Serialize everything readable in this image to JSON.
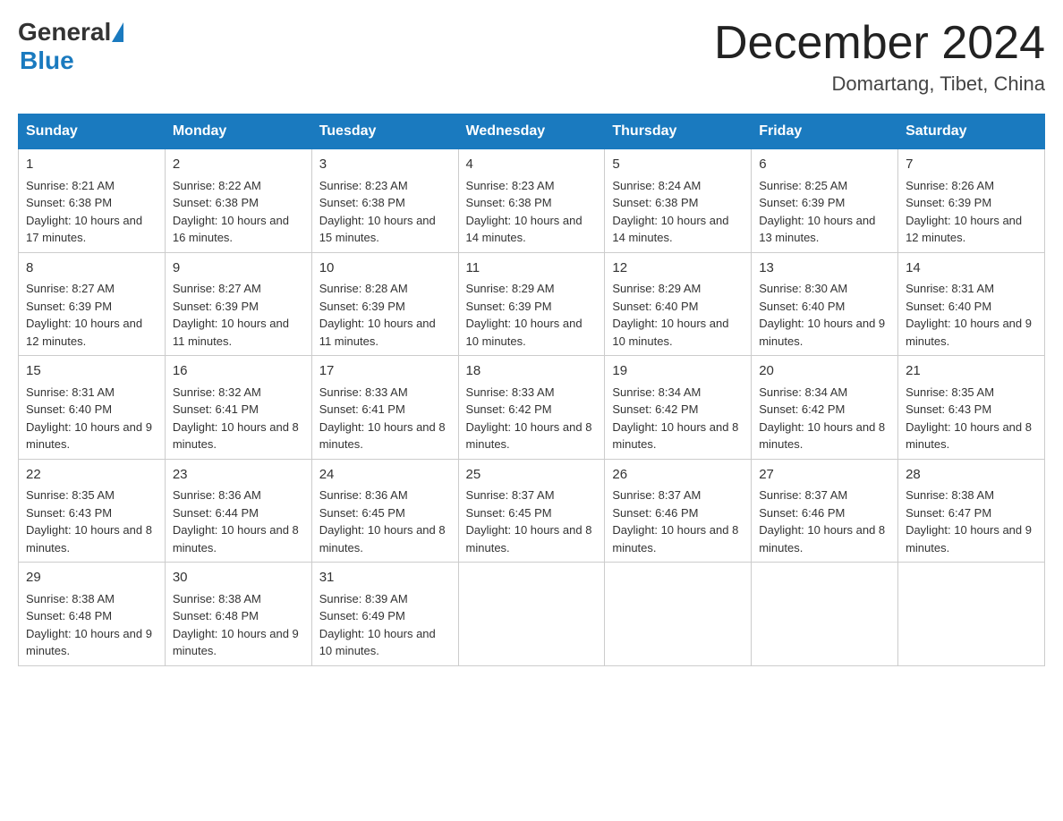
{
  "header": {
    "logo_general": "General",
    "logo_blue": "Blue",
    "month_title": "December 2024",
    "location": "Domartang, Tibet, China"
  },
  "days_of_week": [
    "Sunday",
    "Monday",
    "Tuesday",
    "Wednesday",
    "Thursday",
    "Friday",
    "Saturday"
  ],
  "weeks": [
    [
      {
        "day": "1",
        "sunrise": "8:21 AM",
        "sunset": "6:38 PM",
        "daylight": "10 hours and 17 minutes."
      },
      {
        "day": "2",
        "sunrise": "8:22 AM",
        "sunset": "6:38 PM",
        "daylight": "10 hours and 16 minutes."
      },
      {
        "day": "3",
        "sunrise": "8:23 AM",
        "sunset": "6:38 PM",
        "daylight": "10 hours and 15 minutes."
      },
      {
        "day": "4",
        "sunrise": "8:23 AM",
        "sunset": "6:38 PM",
        "daylight": "10 hours and 14 minutes."
      },
      {
        "day": "5",
        "sunrise": "8:24 AM",
        "sunset": "6:38 PM",
        "daylight": "10 hours and 14 minutes."
      },
      {
        "day": "6",
        "sunrise": "8:25 AM",
        "sunset": "6:39 PM",
        "daylight": "10 hours and 13 minutes."
      },
      {
        "day": "7",
        "sunrise": "8:26 AM",
        "sunset": "6:39 PM",
        "daylight": "10 hours and 12 minutes."
      }
    ],
    [
      {
        "day": "8",
        "sunrise": "8:27 AM",
        "sunset": "6:39 PM",
        "daylight": "10 hours and 12 minutes."
      },
      {
        "day": "9",
        "sunrise": "8:27 AM",
        "sunset": "6:39 PM",
        "daylight": "10 hours and 11 minutes."
      },
      {
        "day": "10",
        "sunrise": "8:28 AM",
        "sunset": "6:39 PM",
        "daylight": "10 hours and 11 minutes."
      },
      {
        "day": "11",
        "sunrise": "8:29 AM",
        "sunset": "6:39 PM",
        "daylight": "10 hours and 10 minutes."
      },
      {
        "day": "12",
        "sunrise": "8:29 AM",
        "sunset": "6:40 PM",
        "daylight": "10 hours and 10 minutes."
      },
      {
        "day": "13",
        "sunrise": "8:30 AM",
        "sunset": "6:40 PM",
        "daylight": "10 hours and 9 minutes."
      },
      {
        "day": "14",
        "sunrise": "8:31 AM",
        "sunset": "6:40 PM",
        "daylight": "10 hours and 9 minutes."
      }
    ],
    [
      {
        "day": "15",
        "sunrise": "8:31 AM",
        "sunset": "6:40 PM",
        "daylight": "10 hours and 9 minutes."
      },
      {
        "day": "16",
        "sunrise": "8:32 AM",
        "sunset": "6:41 PM",
        "daylight": "10 hours and 8 minutes."
      },
      {
        "day": "17",
        "sunrise": "8:33 AM",
        "sunset": "6:41 PM",
        "daylight": "10 hours and 8 minutes."
      },
      {
        "day": "18",
        "sunrise": "8:33 AM",
        "sunset": "6:42 PM",
        "daylight": "10 hours and 8 minutes."
      },
      {
        "day": "19",
        "sunrise": "8:34 AM",
        "sunset": "6:42 PM",
        "daylight": "10 hours and 8 minutes."
      },
      {
        "day": "20",
        "sunrise": "8:34 AM",
        "sunset": "6:42 PM",
        "daylight": "10 hours and 8 minutes."
      },
      {
        "day": "21",
        "sunrise": "8:35 AM",
        "sunset": "6:43 PM",
        "daylight": "10 hours and 8 minutes."
      }
    ],
    [
      {
        "day": "22",
        "sunrise": "8:35 AM",
        "sunset": "6:43 PM",
        "daylight": "10 hours and 8 minutes."
      },
      {
        "day": "23",
        "sunrise": "8:36 AM",
        "sunset": "6:44 PM",
        "daylight": "10 hours and 8 minutes."
      },
      {
        "day": "24",
        "sunrise": "8:36 AM",
        "sunset": "6:45 PM",
        "daylight": "10 hours and 8 minutes."
      },
      {
        "day": "25",
        "sunrise": "8:37 AM",
        "sunset": "6:45 PM",
        "daylight": "10 hours and 8 minutes."
      },
      {
        "day": "26",
        "sunrise": "8:37 AM",
        "sunset": "6:46 PM",
        "daylight": "10 hours and 8 minutes."
      },
      {
        "day": "27",
        "sunrise": "8:37 AM",
        "sunset": "6:46 PM",
        "daylight": "10 hours and 8 minutes."
      },
      {
        "day": "28",
        "sunrise": "8:38 AM",
        "sunset": "6:47 PM",
        "daylight": "10 hours and 9 minutes."
      }
    ],
    [
      {
        "day": "29",
        "sunrise": "8:38 AM",
        "sunset": "6:48 PM",
        "daylight": "10 hours and 9 minutes."
      },
      {
        "day": "30",
        "sunrise": "8:38 AM",
        "sunset": "6:48 PM",
        "daylight": "10 hours and 9 minutes."
      },
      {
        "day": "31",
        "sunrise": "8:39 AM",
        "sunset": "6:49 PM",
        "daylight": "10 hours and 10 minutes."
      },
      null,
      null,
      null,
      null
    ]
  ],
  "labels": {
    "sunrise_prefix": "Sunrise: ",
    "sunset_prefix": "Sunset: ",
    "daylight_prefix": "Daylight: "
  },
  "colors": {
    "header_bg": "#1a7abf",
    "header_text": "#ffffff",
    "border": "#1a7abf",
    "cell_border": "#cccccc"
  }
}
